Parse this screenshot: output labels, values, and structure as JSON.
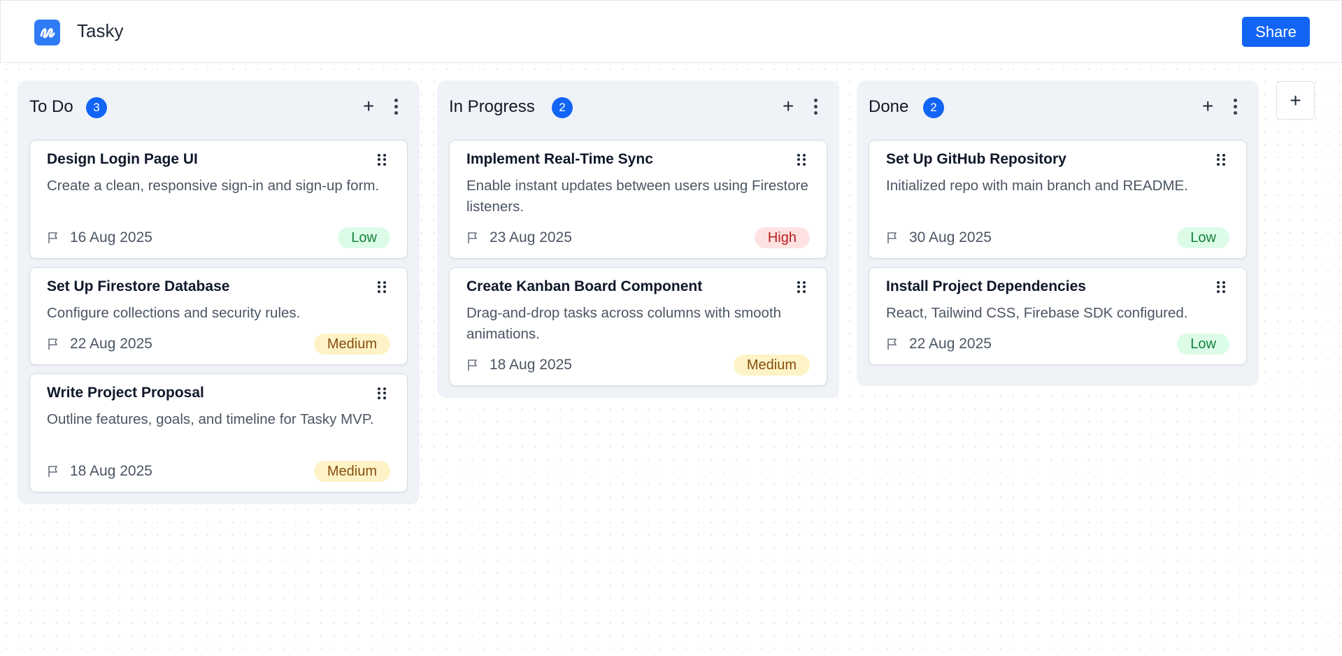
{
  "app": {
    "title": "Tasky",
    "share_label": "Share"
  },
  "add_column_label": "+",
  "columns": [
    {
      "title": "To Do",
      "count": "3",
      "add_label": "+",
      "cards": [
        {
          "title": "Design Login Page UI",
          "desc": "Create a clean, responsive sign-in and sign-up form.",
          "date": "16 Aug 2025",
          "priority": "Low"
        },
        {
          "title": "Set Up Firestore Database",
          "desc": "Configure collections and security rules.",
          "date": "22 Aug 2025",
          "priority": "Medium"
        },
        {
          "title": "Write Project Proposal",
          "desc": "Outline features, goals, and timeline for Tasky MVP.",
          "date": "18 Aug 2025",
          "priority": "Medium"
        }
      ]
    },
    {
      "title": "In Progress",
      "count": "2",
      "add_label": "+",
      "cards": [
        {
          "title": "Implement Real-Time Sync",
          "desc": "Enable instant updates between users using Firestore listeners.",
          "date": "23 Aug 2025",
          "priority": "High"
        },
        {
          "title": "Create Kanban Board Component",
          "desc": "Drag-and-drop tasks across columns with smooth animations.",
          "date": "18 Aug 2025",
          "priority": "Medium"
        }
      ]
    },
    {
      "title": "Done",
      "count": "2",
      "add_label": "+",
      "cards": [
        {
          "title": "Set Up GitHub Repository",
          "desc": "Initialized repo with main branch and README.",
          "date": "30 Aug 2025",
          "priority": "Low"
        },
        {
          "title": "Install Project Dependencies",
          "desc": "React, Tailwind CSS, Firebase SDK configured.",
          "date": "22 Aug 2025",
          "priority": "Low"
        }
      ]
    }
  ],
  "colors": {
    "accent": "#1264f5",
    "low": "#dcfce7",
    "medium": "#fef3c6",
    "high": "#fee2e2"
  },
  "icons": [
    "app-logo-icon",
    "flag-icon",
    "drag-handle-icon",
    "more-vertical-icon",
    "plus-icon"
  ]
}
